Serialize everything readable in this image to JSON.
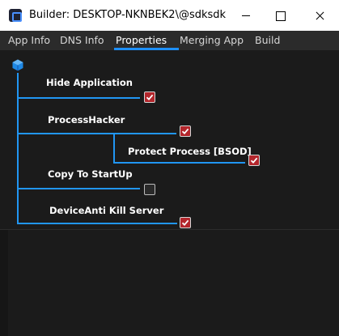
{
  "window": {
    "title": "Builder: DESKTOP-NKNBEK2\\@sdksdk",
    "icon": "app-logo-icon"
  },
  "tabs": [
    {
      "label": "App Info",
      "active": false
    },
    {
      "label": "DNS Info",
      "active": false
    },
    {
      "label": "Properties",
      "active": true
    },
    {
      "label": "Merging App",
      "active": false
    },
    {
      "label": "Build",
      "active": false
    }
  ],
  "tree": {
    "root_icon": "cube-icon",
    "accent_color": "#2196f3",
    "check_color": "#b3262c",
    "items": [
      {
        "label": "Hide Application",
        "checked": true
      },
      {
        "label": "ProcessHacker",
        "checked": true
      },
      {
        "label": "Protect Process [BSOD]",
        "checked": true
      },
      {
        "label": "Copy To StartUp",
        "checked": false
      },
      {
        "label": "DeviceAnti Kill Server",
        "checked": true
      }
    ]
  }
}
